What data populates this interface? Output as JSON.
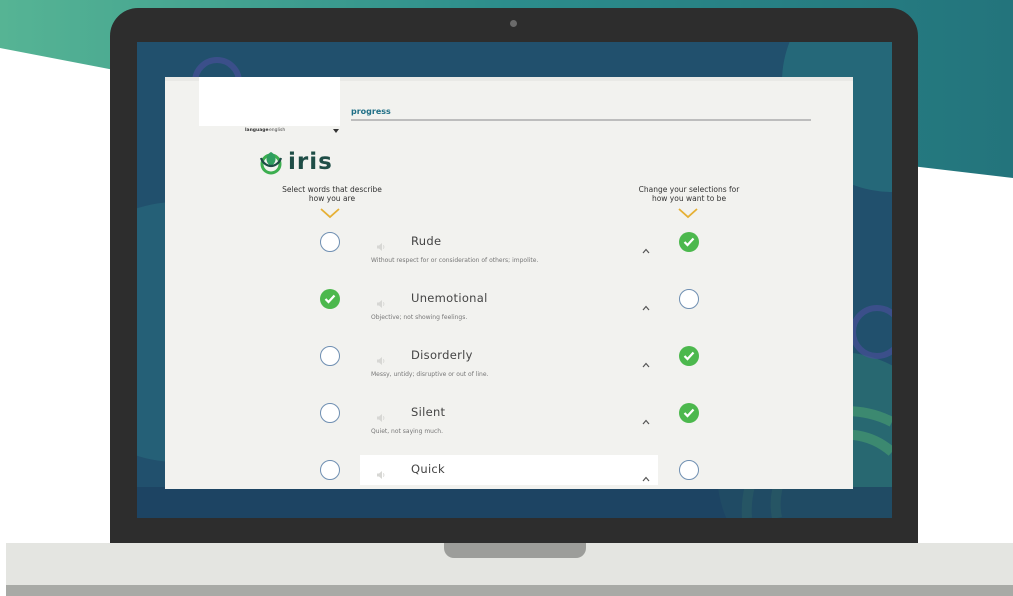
{
  "app": {
    "progress_label": "progress",
    "language_label": "language",
    "language_value": "english",
    "brand_name": "iris",
    "left_header": [
      "Select words that describe",
      "how you are"
    ],
    "right_header": [
      "Change your selections for",
      "how you want to be"
    ]
  },
  "rows": [
    {
      "word": "Rude",
      "definition": "Without respect for or consideration of others; impolite.",
      "now_selected": false,
      "want_selected": true
    },
    {
      "word": "Unemotional",
      "definition": "Objective; not showing feelings.",
      "now_selected": true,
      "want_selected": false
    },
    {
      "word": "Disorderly",
      "definition": "Messy, untidy; disruptive or out of line.",
      "now_selected": false,
      "want_selected": true
    },
    {
      "word": "Silent",
      "definition": "Quiet, not saying much.",
      "now_selected": false,
      "want_selected": true
    },
    {
      "word": "Quick",
      "definition": "",
      "now_selected": false,
      "want_selected": false
    }
  ],
  "icons": {
    "speaker": "speaker-icon",
    "caret": "caret-up-icon",
    "check": "check-icon",
    "chevron": "chevron-down-icon"
  },
  "colors": {
    "check_green": "#4cb84d",
    "circle_outline": "#6f8fb2",
    "accent_teal": "#1f6f86",
    "chevron_gold": "#e6b034",
    "brand_dark": "#1e4d46"
  }
}
